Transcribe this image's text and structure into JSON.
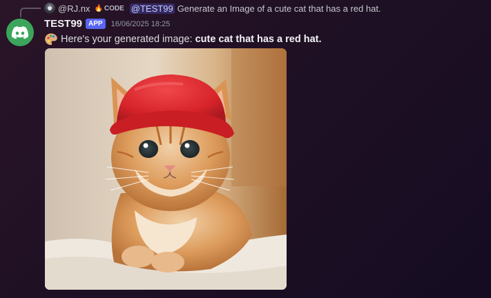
{
  "reply": {
    "username": "@RJ.nx",
    "tag": "CODE",
    "mention": "@TEST99",
    "text": "Generate an Image of a cute cat that has a red hat."
  },
  "message": {
    "author": "TEST99",
    "badge": "APP",
    "timestamp": "16/06/2025 18:25",
    "text_prefix": "Here's your generated image: ",
    "text_bold": "cute cat that has a red hat.",
    "icon": "artist-palette-icon",
    "attachment_icon": "generated-image"
  },
  "colors": {
    "accent": "#5865f2",
    "avatar_bg": "#3ba55c",
    "hat": "#e0282d"
  }
}
